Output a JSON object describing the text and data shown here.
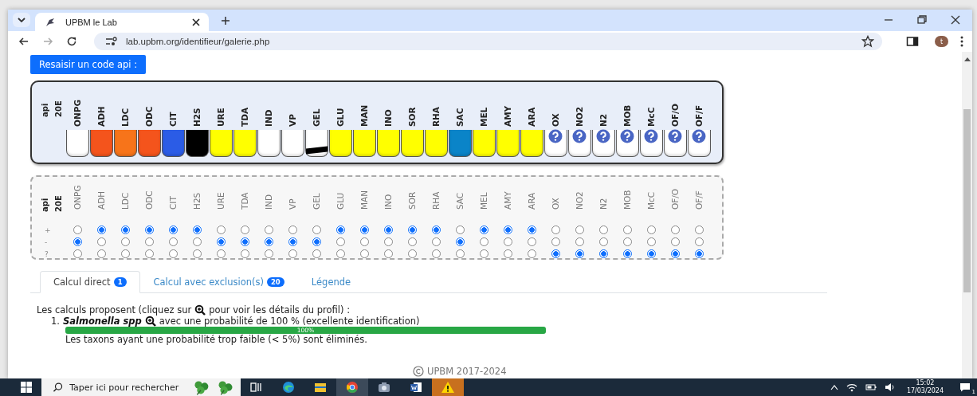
{
  "browser": {
    "tab_title": "UPBM le Lab",
    "url": "lab.upbm.org/identifieur/galerie.php",
    "profile_initial": "t"
  },
  "reenter_button": "Resaisir un code api :",
  "strip": {
    "kit": [
      "api",
      "20E"
    ],
    "tests": [
      {
        "name": "ONPG",
        "kind": "solid",
        "color": "#ffffff"
      },
      {
        "name": "ADH",
        "kind": "solid",
        "color": "#f4541c"
      },
      {
        "name": "LDC",
        "kind": "solid",
        "color": "#f7741a"
      },
      {
        "name": "ODC",
        "kind": "solid",
        "color": "#f4541c"
      },
      {
        "name": "CIT",
        "kind": "solid",
        "color": "#2b5ce6"
      },
      {
        "name": "H2S",
        "kind": "solid",
        "color": "#000000"
      },
      {
        "name": "URE",
        "kind": "solid",
        "color": "#ffff00"
      },
      {
        "name": "TDA",
        "kind": "solid",
        "color": "#ffff00"
      },
      {
        "name": "IND",
        "kind": "solid",
        "color": "#ffffff"
      },
      {
        "name": "VP",
        "kind": "solid",
        "color": "#ffffff"
      },
      {
        "name": "GEL",
        "kind": "gel",
        "color": "#ffffff"
      },
      {
        "name": "GLU",
        "kind": "solid",
        "color": "#ffff00"
      },
      {
        "name": "MAN",
        "kind": "solid",
        "color": "#ffff00"
      },
      {
        "name": "INO",
        "kind": "solid",
        "color": "#ffff00"
      },
      {
        "name": "SOR",
        "kind": "solid",
        "color": "#ffff00"
      },
      {
        "name": "RHA",
        "kind": "solid",
        "color": "#ffff00"
      },
      {
        "name": "SAC",
        "kind": "solid",
        "color": "#0a84c8"
      },
      {
        "name": "MEL",
        "kind": "solid",
        "color": "#ffff00"
      },
      {
        "name": "AMY",
        "kind": "solid",
        "color": "#ffff00"
      },
      {
        "name": "ARA",
        "kind": "solid",
        "color": "#ffff00"
      },
      {
        "name": "OX",
        "kind": "unknown"
      },
      {
        "name": "NO2",
        "kind": "unknown"
      },
      {
        "name": "N2",
        "kind": "unknown"
      },
      {
        "name": "MOB",
        "kind": "unknown"
      },
      {
        "name": "McC",
        "kind": "unknown"
      },
      {
        "name": "OF/O",
        "kind": "unknown"
      },
      {
        "name": "OF/F",
        "kind": "unknown"
      }
    ]
  },
  "form": {
    "kit": [
      "api",
      "20E"
    ],
    "row_labels": [
      "+",
      "-",
      "?"
    ],
    "tests": [
      {
        "name": "ONPG",
        "choices": [
          {
            "selected": false
          },
          {
            "selected": true
          },
          {
            "selected": false
          }
        ]
      },
      {
        "name": "ADH",
        "choices": [
          {
            "selected": true
          },
          {
            "selected": false
          },
          {
            "selected": false
          }
        ]
      },
      {
        "name": "LDC",
        "choices": [
          {
            "selected": true
          },
          {
            "selected": false
          },
          {
            "selected": false
          }
        ]
      },
      {
        "name": "ODC",
        "choices": [
          {
            "selected": true
          },
          {
            "selected": false
          },
          {
            "selected": false
          }
        ]
      },
      {
        "name": "CIT",
        "choices": [
          {
            "selected": true
          },
          {
            "selected": false
          },
          {
            "selected": false
          }
        ]
      },
      {
        "name": "H2S",
        "choices": [
          {
            "selected": true
          },
          {
            "selected": false
          },
          {
            "selected": false
          }
        ]
      },
      {
        "name": "URE",
        "choices": [
          {
            "selected": false
          },
          {
            "selected": true
          },
          {
            "selected": false
          }
        ]
      },
      {
        "name": "TDA",
        "choices": [
          {
            "selected": false
          },
          {
            "selected": true
          },
          {
            "selected": false
          }
        ]
      },
      {
        "name": "IND",
        "choices": [
          {
            "selected": false
          },
          {
            "selected": true
          },
          {
            "selected": false
          }
        ]
      },
      {
        "name": "VP",
        "choices": [
          {
            "selected": false
          },
          {
            "selected": true
          },
          {
            "selected": false
          }
        ]
      },
      {
        "name": "GEL",
        "choices": [
          {
            "selected": false
          },
          {
            "selected": true
          },
          {
            "selected": false
          }
        ]
      },
      {
        "name": "GLU",
        "choices": [
          {
            "selected": true
          },
          {
            "selected": false
          },
          {
            "selected": false
          }
        ]
      },
      {
        "name": "MAN",
        "choices": [
          {
            "selected": true
          },
          {
            "selected": false
          },
          {
            "selected": false
          }
        ]
      },
      {
        "name": "INO",
        "choices": [
          {
            "selected": true
          },
          {
            "selected": false
          },
          {
            "selected": false
          }
        ]
      },
      {
        "name": "SOR",
        "choices": [
          {
            "selected": true
          },
          {
            "selected": false
          },
          {
            "selected": false
          }
        ]
      },
      {
        "name": "RHA",
        "choices": [
          {
            "selected": true
          },
          {
            "selected": false
          },
          {
            "selected": false
          }
        ]
      },
      {
        "name": "SAC",
        "choices": [
          {
            "selected": false
          },
          {
            "selected": true
          },
          {
            "selected": false
          }
        ]
      },
      {
        "name": "MEL",
        "choices": [
          {
            "selected": true
          },
          {
            "selected": false
          },
          {
            "selected": false
          }
        ]
      },
      {
        "name": "AMY",
        "choices": [
          {
            "selected": true
          },
          {
            "selected": false
          },
          {
            "selected": false
          }
        ]
      },
      {
        "name": "ARA",
        "choices": [
          {
            "selected": true
          },
          {
            "selected": false
          },
          {
            "selected": false
          }
        ]
      },
      {
        "name": "OX",
        "choices": [
          {
            "selected": false
          },
          {
            "selected": false
          },
          {
            "selected": true
          }
        ]
      },
      {
        "name": "NO2",
        "choices": [
          {
            "selected": false
          },
          {
            "selected": false
          },
          {
            "selected": true
          }
        ]
      },
      {
        "name": "N2",
        "choices": [
          {
            "selected": false
          },
          {
            "selected": false
          },
          {
            "selected": true
          }
        ]
      },
      {
        "name": "MOB",
        "choices": [
          {
            "selected": false
          },
          {
            "selected": false
          },
          {
            "selected": true
          }
        ]
      },
      {
        "name": "McC",
        "choices": [
          {
            "selected": false
          },
          {
            "selected": false
          },
          {
            "selected": true
          }
        ]
      },
      {
        "name": "OF/O",
        "choices": [
          {
            "selected": false
          },
          {
            "selected": false
          },
          {
            "selected": true
          }
        ]
      },
      {
        "name": "OF/F",
        "choices": [
          {
            "selected": false
          },
          {
            "selected": false
          },
          {
            "selected": true
          }
        ]
      }
    ]
  },
  "tabs": [
    {
      "label": "Calcul direct",
      "count": "1",
      "selected": true
    },
    {
      "label": "Calcul avec exclusion(s)",
      "count": "20",
      "selected": false
    },
    {
      "label": "Légende",
      "selected": false
    }
  ],
  "results": {
    "intro_before": "Les calculs proposent (cliquez sur",
    "intro_after": "pour voir les détails du profil) :",
    "items": [
      {
        "number": "1.",
        "taxon": "Salmonella spp",
        "text": "avec une probabilité de 100 % (excellente identification)",
        "level": 1,
        "reading": "100%"
      }
    ],
    "note": "Les taxons ayant une probabilité trop faible (< 5%) sont éliminés."
  },
  "footer": "UPBM 2017-2024",
  "taskbar": {
    "search_placeholder": "Taper ici pour rechercher",
    "apps": [
      {
        "kind": "taskview",
        "selected": false
      },
      {
        "kind": "edge",
        "selected": false
      },
      {
        "kind": "folder",
        "selected": false
      },
      {
        "kind": "chrome",
        "selected": true
      },
      {
        "kind": "camera",
        "selected": false
      },
      {
        "kind": "word",
        "selected": false
      },
      {
        "kind": "warning",
        "selected": false
      }
    ],
    "time": "15:02",
    "date": "17/03/2024",
    "notification_count": "1"
  }
}
